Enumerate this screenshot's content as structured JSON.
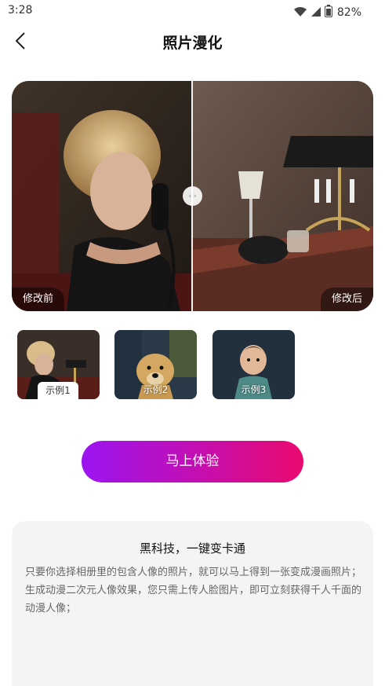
{
  "status_bar": {
    "time": "3:28",
    "battery_text": "82%",
    "icons": [
      "wifi-icon",
      "signal-icon",
      "battery-icon"
    ]
  },
  "nav": {
    "title": "照片漫化",
    "back_icon": "chevron-left-icon"
  },
  "compare": {
    "before_label": "修改前",
    "after_label": "修改后",
    "slider_icon": "compare-slider-icon"
  },
  "examples": [
    {
      "label": "示例1",
      "selected": true
    },
    {
      "label": "示例2",
      "selected": false
    },
    {
      "label": "示例3",
      "selected": false
    }
  ],
  "cta": {
    "label": "马上体验",
    "gradient_start": "#9b14f0",
    "gradient_end": "#ea0a6e"
  },
  "info": {
    "title": "黑科技，一键变卡通",
    "paragraphs": [
      "只要你选择相册里的包含人像的照片，就可以马上得到一张变成漫画照片；",
      "生成动漫二次元人像效果，您只需上传人脸图片，即可立刻获得千人千面的动漫人像；"
    ]
  }
}
